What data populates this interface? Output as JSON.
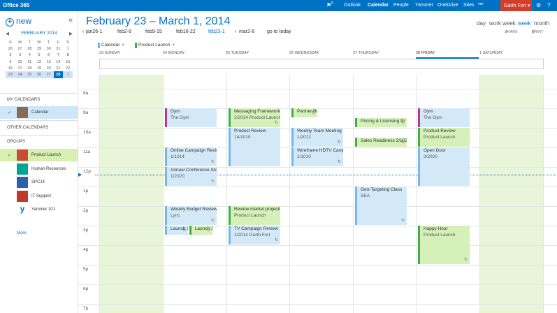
{
  "topbar": {
    "brand": "Office 365",
    "notif_icon": "flag-icon",
    "notif_count": "5",
    "nav": [
      "Outlook",
      "Calendar",
      "People",
      "Yammer",
      "OneDrive",
      "Sites"
    ],
    "active_nav": "Calendar",
    "more": "•••",
    "user": "Garth Fort",
    "settings_icon": "⚙",
    "help_icon": "?"
  },
  "sidebar": {
    "new_label": "new",
    "collapse": "«",
    "mini_cal": {
      "month": "FEBRUARY 2014",
      "prev": "◀",
      "next": "▶",
      "days": [
        "S",
        "M",
        "T",
        "W",
        "T",
        "F",
        "S"
      ],
      "weeks": [
        [
          "26",
          "27",
          "28",
          "29",
          "30",
          "31",
          "1"
        ],
        [
          "2",
          "3",
          "4",
          "5",
          "6",
          "7",
          "8"
        ],
        [
          "9",
          "10",
          "11",
          "12",
          "13",
          "14",
          "15"
        ],
        [
          "16",
          "17",
          "18",
          "19",
          "20",
          "21",
          "22"
        ],
        [
          "23",
          "24",
          "25",
          "26",
          "27",
          "28",
          "1"
        ]
      ],
      "today": "28"
    },
    "my_calendars_label": "MY CALENDARS",
    "my_calendars": [
      {
        "label": "Calendar",
        "checked": true
      }
    ],
    "other_calendars_label": "OTHER CALENDARS",
    "groups_label": "GROUPS",
    "groups": [
      {
        "label": "Product Launch",
        "checked": true,
        "color": "#c94b34",
        "icon": "chart-icon"
      },
      {
        "label": "Human Resources",
        "checked": false,
        "color": "#00a596",
        "icon": "people-icon"
      },
      {
        "label": "SPC14",
        "checked": false,
        "color": "#2d62a8",
        "icon": "spc-icon"
      },
      {
        "label": "IT Support",
        "checked": false,
        "color": "#c0392b",
        "icon": "tools-icon"
      },
      {
        "label": "Yammer 101",
        "checked": false,
        "color": "#ffffff",
        "icon": "yammer-icon"
      }
    ],
    "more_label": "More"
  },
  "header": {
    "title": "February 23 – March 1, 2014",
    "prev_arrow": "‹",
    "weeks": [
      "jan26-1",
      "feb2-8",
      "feb9-15",
      "feb16-22",
      "feb23-1",
      "mar2-8"
    ],
    "active_week": "feb23-1",
    "next_arrow": "›",
    "go_today": "go to today",
    "views": [
      "day",
      "work week",
      "week",
      "month"
    ],
    "active_view": "week",
    "share_label": "SHARE",
    "print_label": "PRINT"
  },
  "filters": [
    {
      "label": "Calendar",
      "color": "#75b7e6",
      "remove": "×"
    },
    {
      "label": "Product Launch",
      "color": "#3fae49",
      "remove": "×"
    }
  ],
  "days": [
    "23 SUNDAY",
    "24 MONDAY",
    "25 TUESDAY",
    "26 WEDNESDAY",
    "27 THURSDAY",
    "28 FRIDAY",
    "1 SATURDAY"
  ],
  "hours": [
    "8a",
    "9a",
    "10a",
    "11a",
    "12p",
    "1p",
    "2p",
    "3p",
    "4p",
    "5p",
    "6p",
    "7p"
  ],
  "events": [
    {
      "day": 1,
      "start": 9,
      "end": 10,
      "title": "Gym",
      "sub": "The Gym",
      "kind": "blue",
      "bar": "pbar",
      "repeat": false
    },
    {
      "day": 2,
      "start": 9,
      "end": 10,
      "title": "Messaging Framework",
      "sub": "2/2014 Product Launch",
      "kind": "green",
      "bar": "gbar",
      "repeat": true
    },
    {
      "day": 3,
      "start": 9,
      "end": 9.5,
      "title": "Partner Readiness Pro",
      "sub": "",
      "kind": "green",
      "bar": "gbar",
      "repeat": true,
      "wfrac": 0.5
    },
    {
      "day": 4,
      "start": 9.5,
      "end": 10,
      "title": "Pricing & Licensing Pr",
      "sub": "",
      "kind": "green",
      "bar": "gbar",
      "repeat": true
    },
    {
      "day": 5,
      "start": 9,
      "end": 10,
      "title": "Gym",
      "sub": "The Gym",
      "kind": "blue",
      "bar": "pbar",
      "repeat": false
    },
    {
      "day": 2,
      "start": 10,
      "end": 12,
      "title": "Product Review",
      "sub": "14/1010",
      "kind": "blue",
      "bar": "bbar",
      "repeat": false
    },
    {
      "day": 3,
      "start": 10,
      "end": 11,
      "title": "Weekly Team Meeting",
      "sub": "1/2012",
      "kind": "blue",
      "bar": "bbar",
      "repeat": true
    },
    {
      "day": 5,
      "start": 10,
      "end": 11,
      "title": "Product Review",
      "sub": "Product Launch",
      "kind": "green",
      "bar": "gbar",
      "repeat": false
    },
    {
      "day": 4,
      "start": 10.5,
      "end": 11,
      "title": "Sales Readiness 2/102",
      "sub": "",
      "kind": "green",
      "bar": "gbar",
      "repeat": true
    },
    {
      "day": 1,
      "start": 11,
      "end": 12,
      "title": "Online Campaign Review",
      "sub": "1/1014",
      "kind": "blue",
      "bar": "bbar",
      "repeat": true
    },
    {
      "day": 3,
      "start": 11,
      "end": 12,
      "title": "Wireframe HDTV Campai",
      "sub": "1/1010",
      "kind": "blue",
      "bar": "bbar",
      "repeat": true
    },
    {
      "day": 5,
      "start": 11,
      "end": 13,
      "title": "Open Door",
      "sub": "2/2020",
      "kind": "blue",
      "bar": "bbar",
      "repeat": false
    },
    {
      "day": 1,
      "start": 12,
      "end": 13,
      "title": "Annual Conference Statu",
      "sub": "1/2020",
      "kind": "blue",
      "bar": "bbar",
      "repeat": true
    },
    {
      "day": 4,
      "start": 13,
      "end": 15,
      "title": "Geo-Targeting Class",
      "sub": "SEA",
      "kind": "blue",
      "bar": "bbar",
      "repeat": true
    },
    {
      "day": 1,
      "start": 14,
      "end": 15,
      "title": "Weekly Budget Review",
      "sub": "Lync",
      "kind": "blue",
      "bar": "bbar",
      "repeat": true
    },
    {
      "day": 2,
      "start": 14,
      "end": 15,
      "title": "Review market projection",
      "sub": "Product Launch",
      "kind": "green",
      "bar": "gbar",
      "repeat": false
    },
    {
      "day": 1,
      "start": 15,
      "end": 15.5,
      "title": "Launch 1",
      "sub": "",
      "kind": "blue",
      "bar": "bbar",
      "repeat": true,
      "wfrac": 0.45
    },
    {
      "day": 1,
      "start": 15,
      "end": 15.5,
      "title": "Launch 1",
      "sub": "",
      "kind": "green",
      "bar": "gbar",
      "repeat": true,
      "wfrac": 0.45,
      "woff": 0.47
    },
    {
      "day": 2,
      "start": 15,
      "end": 16,
      "title": "TV Campaign Review",
      "sub": "1/2014 Garth Fort",
      "kind": "blue",
      "bar": "bbar",
      "repeat": true
    },
    {
      "day": 5,
      "start": 15,
      "end": 17,
      "title": "Happy Hour",
      "sub": "Product Launch",
      "kind": "green",
      "bar": "gbar",
      "repeat": true
    }
  ]
}
